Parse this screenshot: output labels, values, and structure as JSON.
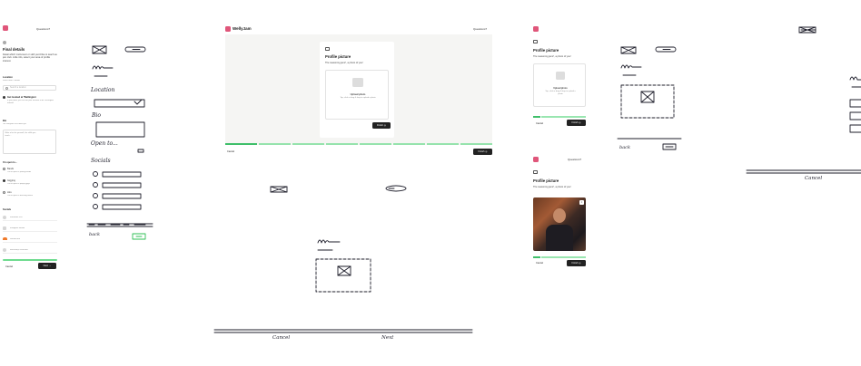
{
  "app": {
    "brand": "WellyJam",
    "questions_link": "Questions?"
  },
  "screen_details": {
    "title": "Final details",
    "subtitle": "Detail which instrument or skill you'd like to teach as jam club. Little info, select your area of profile interest.",
    "location_label": "Location",
    "location_hint": "Which town / suburb",
    "location_placeholder": "Search a location",
    "inperson_label": "Get located at 'Wellington'",
    "inperson_hint": "If you prefer, you can set your location to be 'Wellington' instead",
    "bio_label": "Bio",
    "bio_hint": "Tell everyone a bit about you",
    "bio_placeholder": "Write a bio for yourself, the skills you teach...",
    "open_to_label": "I'm open to...",
    "open_options": [
      {
        "label": "Bands",
        "hint": "You're open to joining bands",
        "selected": false
      },
      {
        "label": "Gigging",
        "hint": "You're open to playing gigs",
        "selected": true
      },
      {
        "label": "Hire",
        "hint": "You're open to teaching others",
        "selected": false
      }
    ],
    "socials_label": "Socials",
    "socials": [
      {
        "icon": "facebook-icon",
        "placeholder": "Facebook URL"
      },
      {
        "icon": "instagram-icon",
        "placeholder": "Instagram handle"
      },
      {
        "icon": "soundcloud-icon",
        "placeholder": "SoundCloud"
      },
      {
        "icon": "bandcamp-icon",
        "placeholder": "Bandcamp username"
      }
    ],
    "progress": 1.0,
    "cancel_label": "Cancel",
    "next_label": "Next"
  },
  "screen_profile": {
    "section_icon": "image-icon",
    "title": "Profile picture",
    "subtitle": "The reasoning jamr!, a photo of you!",
    "upload_label": "Upload photo",
    "upload_hint": "Tap, click or drag & drop to upload a photo",
    "finish_label": "Finish",
    "cancel_label": "Cancel",
    "progress_segments": 8,
    "progress_filled": 1
  },
  "sketch_text": {
    "location": "Location",
    "bio": "Bio",
    "open_to": "Open to...",
    "socials": "Socials",
    "back": "back",
    "cancel": "Cancel",
    "next": "Next"
  },
  "colors": {
    "accent_green": "#6edb8f",
    "logo_pink": "#e0567a",
    "button_dark": "#222222"
  }
}
